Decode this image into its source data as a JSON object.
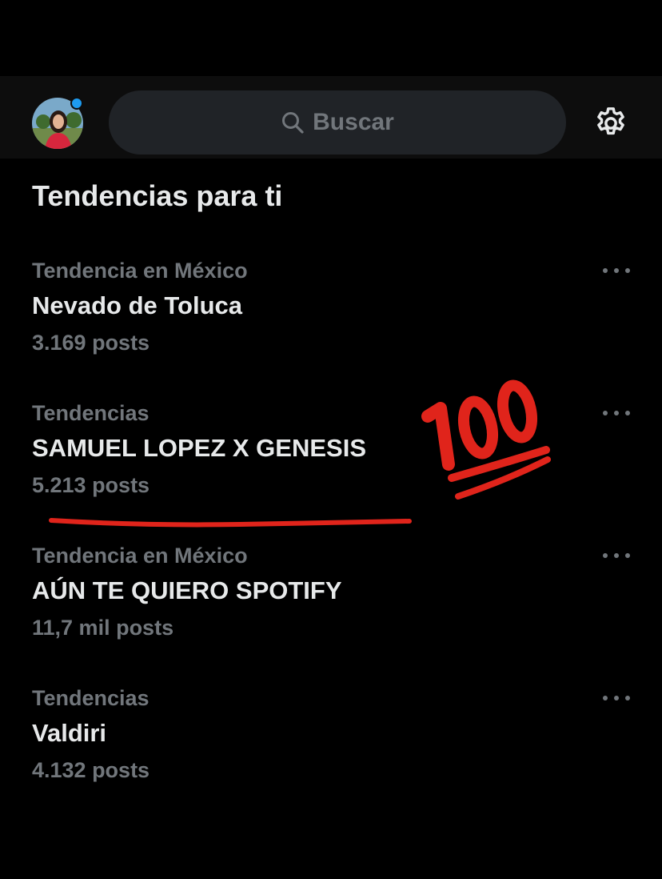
{
  "header": {
    "search_placeholder": "Buscar",
    "icons": {
      "search": "search-icon",
      "settings": "gear-icon"
    },
    "accent_color": "#1d9bf0"
  },
  "section_title": "Tendencias para ti",
  "trends": [
    {
      "category": "Tendencia en México",
      "name": "Nevado de Toluca",
      "count": "3.169 posts"
    },
    {
      "category": "Tendencias",
      "name": "SAMUEL LOPEZ X GENESIS",
      "count": "5.213 posts"
    },
    {
      "category": "Tendencia en México",
      "name": "AÚN TE QUIERO SPOTIFY",
      "count": "11,7 mil posts"
    },
    {
      "category": "Tendencias",
      "name": "Valdiri",
      "count": "4.132 posts"
    }
  ],
  "annotations": {
    "sticker": "hundred-points-emoji",
    "underline_color": "#e0241b"
  }
}
